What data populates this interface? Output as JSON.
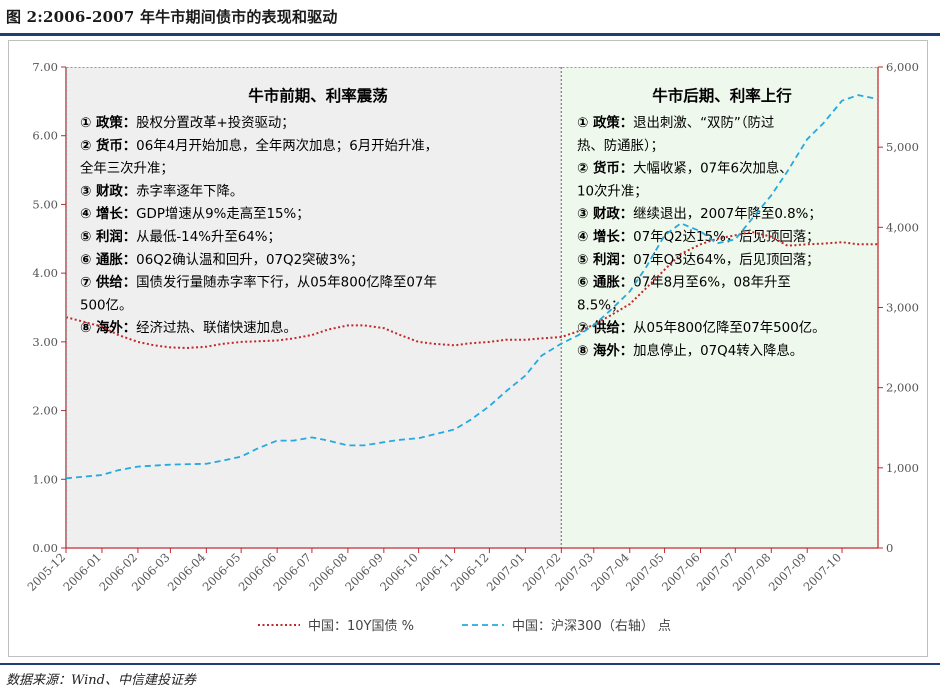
{
  "figure": {
    "title": "图 2:2006-2007 年牛市期间债市的表现和驱动",
    "source": "数据来源：Wind、中信建投证券"
  },
  "colors": {
    "bond_line": "#c0282d",
    "hs300_line": "#25a9e0",
    "left_panel_bg": "#efefef",
    "right_panel_bg": "#eef8ec",
    "rule": "#1f3e73",
    "axis": "#c0282d"
  },
  "annotations": {
    "left": {
      "title": "牛市前期、利率震荡",
      "items": [
        {
          "key": "① 政策：",
          "text": "股权分置改革+投资驱动；"
        },
        {
          "key": "② 货币：",
          "text": "06年4月开始加息，全年两次加息；6月开始升准，"
        },
        {
          "key": "",
          "text": "全年三次升准；"
        },
        {
          "key": "③ 财政：",
          "text": "赤字率逐年下降。"
        },
        {
          "key": "④ 增长：",
          "text": "GDP增速从9%走高至15%；"
        },
        {
          "key": "⑤ 利润：",
          "text": "从最低-14%升至64%；"
        },
        {
          "key": "⑥ 通胀：",
          "text": "06Q2确认温和回升，07Q2突破3%；"
        },
        {
          "key": "⑦ 供给：",
          "text": "国债发行量随赤字率下行，从05年800亿降至07年"
        },
        {
          "key": "",
          "text": "500亿。"
        },
        {
          "key": "⑧ 海外：",
          "text": "经济过热、联储快速加息。"
        }
      ]
    },
    "right": {
      "title": "牛市后期、利率上行",
      "items": [
        {
          "key": "① 政策：",
          "text": "退出刺激、“双防”（防过"
        },
        {
          "key": "",
          "text": "热、防通胀）；"
        },
        {
          "key": "② 货币：",
          "text": "大幅收紧，07年6次加息、"
        },
        {
          "key": "",
          "text": "10次升准；"
        },
        {
          "key": "③ 财政：",
          "text": "继续退出，2007年降至0.8%；"
        },
        {
          "key": "④ 增长：",
          "text": "07年Q2达15%，后见顶回落；"
        },
        {
          "key": "⑤ 利润：",
          "text": "07年Q3达64%，后见顶回落；"
        },
        {
          "key": "⑥ 通胀：",
          "text": "07年8月至6%，08年升至"
        },
        {
          "key": "",
          "text": "8.5%；"
        },
        {
          "key": "⑦ 供给：",
          "text": "从05年800亿降至07年500亿。"
        },
        {
          "key": "⑧ 海外：",
          "text": "加息停止，07Q4转入降息。"
        }
      ]
    }
  },
  "chart_data": {
    "type": "line",
    "x": [
      "2005-12",
      "2006-01",
      "2006-02",
      "2006-03",
      "2006-04",
      "2006-05",
      "2006-06",
      "2006-07",
      "2006-08",
      "2006-09",
      "2006-10",
      "2006-11",
      "2006-12",
      "2007-01",
      "2007-02",
      "2007-03",
      "2007-04",
      "2007-05",
      "2007-06",
      "2007-07",
      "2007-08",
      "2007-09",
      "2007-10"
    ],
    "x_range": [
      "2005-12",
      "2007-11"
    ],
    "y_left": {
      "range": [
        0,
        7
      ],
      "ticks": [
        "0.00",
        "1.00",
        "2.00",
        "3.00",
        "4.00",
        "5.00",
        "6.00",
        "7.00"
      ]
    },
    "y_right": {
      "range": [
        0,
        6000
      ],
      "ticks": [
        "0",
        "1,000",
        "2,000",
        "3,000",
        "4,000",
        "5,000",
        "6,000"
      ]
    },
    "divider_at": "2007-02",
    "series": [
      {
        "name": "中国：10Y国债 %",
        "axis": "left",
        "style": "dotted",
        "points": [
          [
            "2005-12",
            3.36
          ],
          [
            "2006-01",
            3.22
          ],
          [
            "2006-01-15",
            3.1
          ],
          [
            "2006-02",
            3.0
          ],
          [
            "2006-02-15",
            2.95
          ],
          [
            "2006-03",
            2.92
          ],
          [
            "2006-03-15",
            2.91
          ],
          [
            "2006-04",
            2.93
          ],
          [
            "2006-04-15",
            2.97
          ],
          [
            "2006-05",
            3.0
          ],
          [
            "2006-06",
            3.02
          ],
          [
            "2006-06-15",
            3.05
          ],
          [
            "2006-07",
            3.1
          ],
          [
            "2006-07-15",
            3.18
          ],
          [
            "2006-08",
            3.24
          ],
          [
            "2006-08-15",
            3.24
          ],
          [
            "2006-09",
            3.2
          ],
          [
            "2006-09-15",
            3.1
          ],
          [
            "2006-10",
            3.0
          ],
          [
            "2006-10-15",
            2.97
          ],
          [
            "2006-11",
            2.95
          ],
          [
            "2006-11-15",
            2.98
          ],
          [
            "2006-12",
            3.0
          ],
          [
            "2006-12-15",
            3.03
          ],
          [
            "2007-01",
            3.03
          ],
          [
            "2007-01-15",
            3.05
          ],
          [
            "2007-02",
            3.07
          ],
          [
            "2007-02-15",
            3.15
          ],
          [
            "2007-03",
            3.25
          ],
          [
            "2007-03-15",
            3.38
          ],
          [
            "2007-04",
            3.55
          ],
          [
            "2007-04-15",
            3.78
          ],
          [
            "2007-05",
            4.05
          ],
          [
            "2007-05-15",
            4.28
          ],
          [
            "2007-06",
            4.42
          ],
          [
            "2007-06-15",
            4.5
          ],
          [
            "2007-07",
            4.55
          ],
          [
            "2007-07-15",
            4.6
          ],
          [
            "2007-08",
            4.53
          ],
          [
            "2007-08-15",
            4.4
          ],
          [
            "2007-09",
            4.42
          ],
          [
            "2007-09-15",
            4.43
          ],
          [
            "2007-10",
            4.45
          ],
          [
            "2007-10-15",
            4.42
          ],
          [
            "2007-11",
            4.42
          ]
        ]
      },
      {
        "name": "中国：沪深300（右轴） 点",
        "axis": "right",
        "style": "dashed",
        "points": [
          [
            "2005-12",
            870
          ],
          [
            "2006-01",
            910
          ],
          [
            "2006-01-15",
            970
          ],
          [
            "2006-02",
            1015
          ],
          [
            "2006-03",
            1040
          ],
          [
            "2006-04",
            1050
          ],
          [
            "2006-04-15",
            1090
          ],
          [
            "2006-05",
            1140
          ],
          [
            "2006-05-15",
            1240
          ],
          [
            "2006-06",
            1340
          ],
          [
            "2006-06-15",
            1340
          ],
          [
            "2006-07",
            1380
          ],
          [
            "2006-07-15",
            1340
          ],
          [
            "2006-08",
            1280
          ],
          [
            "2006-08-15",
            1280
          ],
          [
            "2006-09",
            1320
          ],
          [
            "2006-09-15",
            1350
          ],
          [
            "2006-10",
            1370
          ],
          [
            "2006-10-15",
            1420
          ],
          [
            "2006-11",
            1480
          ],
          [
            "2006-11-15",
            1600
          ],
          [
            "2006-12",
            1770
          ],
          [
            "2006-12-15",
            1950
          ],
          [
            "2007-01",
            2150
          ],
          [
            "2007-01-15",
            2400
          ],
          [
            "2007-02",
            2550
          ],
          [
            "2007-02-15",
            2650
          ],
          [
            "2007-03",
            2780
          ],
          [
            "2007-03-15",
            2960
          ],
          [
            "2007-04",
            3200
          ],
          [
            "2007-04-15",
            3500
          ],
          [
            "2007-05",
            3900
          ],
          [
            "2007-05-15",
            4050
          ],
          [
            "2007-06",
            3950
          ],
          [
            "2007-06-15",
            3800
          ],
          [
            "2007-07",
            3850
          ],
          [
            "2007-07-15",
            4100
          ],
          [
            "2007-08",
            4400
          ],
          [
            "2007-08-15",
            4700
          ],
          [
            "2007-09",
            5100
          ],
          [
            "2007-09-15",
            5300
          ],
          [
            "2007-10",
            5580
          ],
          [
            "2007-10-15",
            5650
          ],
          [
            "2007-11",
            5600
          ]
        ]
      }
    ],
    "legend": {
      "position": "bottom",
      "entries": [
        "中国：10Y国债 %",
        "中国：沪深300（右轴） 点"
      ]
    }
  }
}
